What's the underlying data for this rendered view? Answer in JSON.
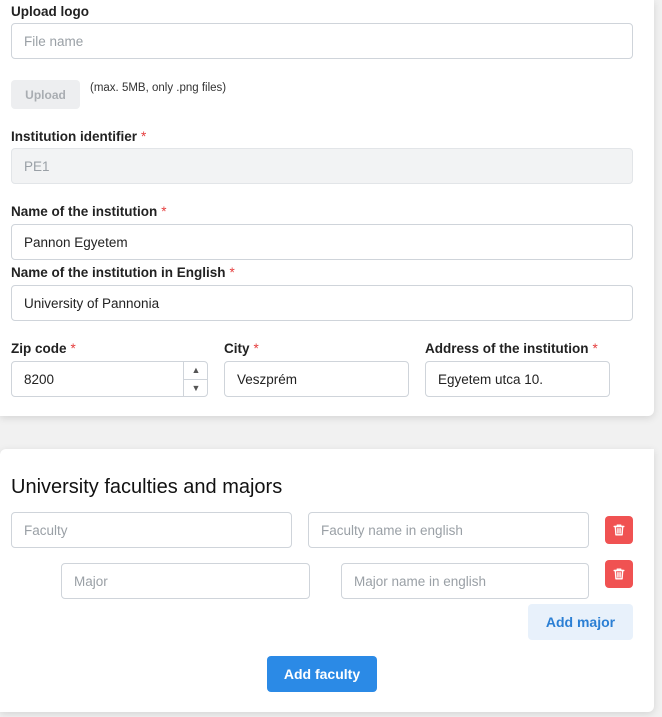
{
  "upload": {
    "label": "Upload logo",
    "file_placeholder": "File name",
    "button_label": "Upload",
    "hint": "(max. 5MB, only .png files)"
  },
  "institution": {
    "identifier_label": "Institution identifier",
    "identifier_value": "PE1",
    "name_label": "Name of the institution",
    "name_value": "Pannon Egyetem",
    "name_en_label": "Name of the institution in English",
    "name_en_value": "University of Pannonia",
    "zip_label": "Zip code",
    "zip_value": "8200",
    "city_label": "City",
    "city_value": "Veszprém",
    "address_label": "Address of the institution",
    "address_value": "Egyetem utca 10.",
    "required_mark": "*"
  },
  "faculties": {
    "title": "University faculties and majors",
    "faculty_placeholder": "Faculty",
    "faculty_en_placeholder": "Faculty name in english",
    "major_placeholder": "Major",
    "major_en_placeholder": "Major name in english",
    "add_major_label": "Add major",
    "add_faculty_label": "Add faculty"
  },
  "colors": {
    "accent": "#2b8ae6",
    "danger": "#f05252",
    "required": "#e53e3e"
  }
}
